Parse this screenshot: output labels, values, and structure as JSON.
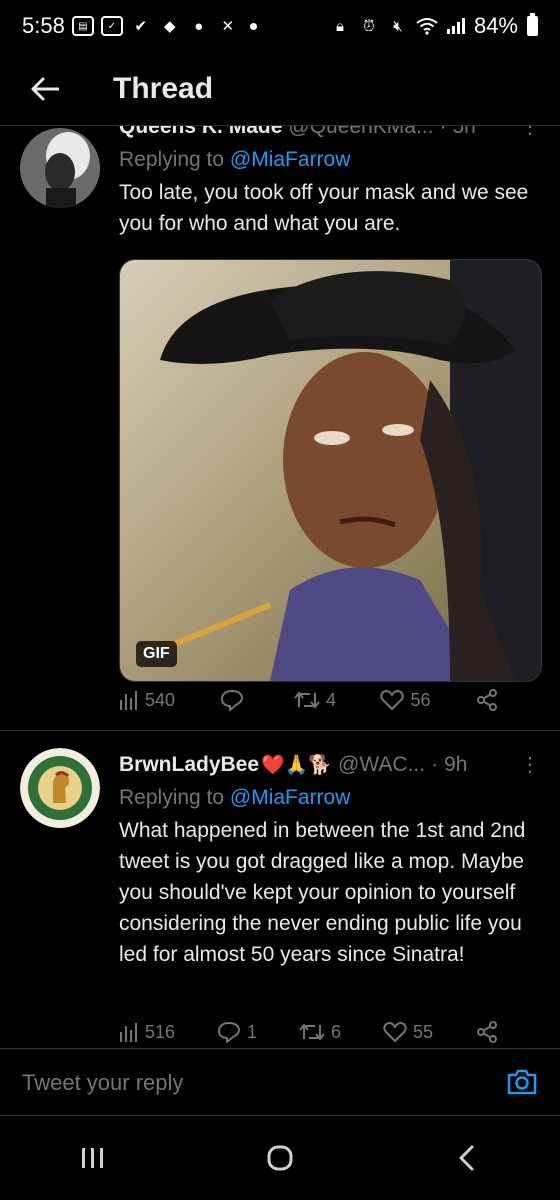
{
  "status_bar": {
    "time": "5:58",
    "battery": "84%"
  },
  "header": {
    "title": "Thread"
  },
  "tweets": [
    {
      "name": "Queens K. Made",
      "handle": "@QueenKMa...",
      "time": "5h",
      "replying_prefix": "Replying to",
      "replying_to": "@MiaFarrow",
      "text": "Too late, you took off your mask and we see you for who and what you are.",
      "media_badge": "GIF",
      "stats": {
        "views": "540",
        "replies": "",
        "retweets": "4",
        "likes": "56"
      }
    },
    {
      "name": "BrwnLadyBee",
      "name_emoji": "❤️🙏🐕",
      "handle": "@WAC...",
      "time": "9h",
      "replying_prefix": "Replying to",
      "replying_to": "@MiaFarrow",
      "text": "What happened in between the 1st and 2nd tweet is you got dragged like a mop. Maybe you should've kept your opinion to yourself considering the never ending public life you led for almost 50 years since Sinatra!",
      "stats": {
        "views": "516",
        "replies": "1",
        "retweets": "6",
        "likes": "55"
      }
    }
  ],
  "reply_bar": {
    "placeholder": "Tweet your reply"
  },
  "colors": {
    "background": "#000000",
    "accent": "#1d9bf0",
    "secondary_text": "#71767b",
    "primary_text": "#e7e9ea"
  },
  "icons": [
    "back-arrow-icon",
    "views-icon",
    "reply-icon",
    "retweet-icon",
    "like-icon",
    "share-icon",
    "camera-icon",
    "recents-icon",
    "home-icon",
    "nav-back-icon"
  ]
}
